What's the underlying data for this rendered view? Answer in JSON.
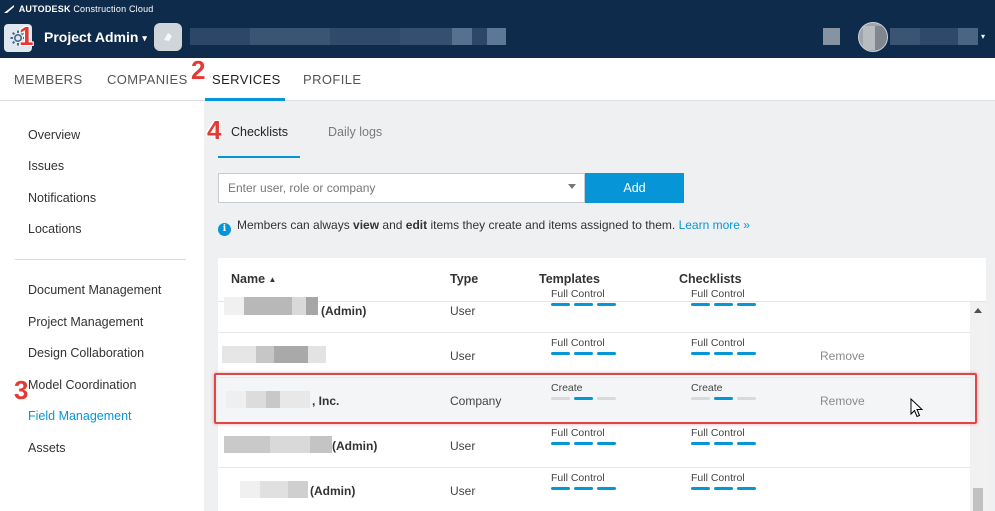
{
  "header": {
    "brand": "AUTODESK",
    "brand_sub": "Construction Cloud",
    "app_title": "Project Admin",
    "app_caret": "▾",
    "avatar_caret": "▾"
  },
  "main_nav": {
    "tabs": [
      {
        "label": "MEMBERS"
      },
      {
        "label": "COMPANIES"
      },
      {
        "label": "SERVICES"
      },
      {
        "label": "PROFILE"
      }
    ],
    "active": "SERVICES"
  },
  "sidebar": {
    "group1": [
      {
        "label": "Overview"
      },
      {
        "label": "Issues"
      },
      {
        "label": "Notifications"
      },
      {
        "label": "Locations"
      }
    ],
    "group2": [
      {
        "label": "Document Management"
      },
      {
        "label": "Project Management"
      },
      {
        "label": "Design Collaboration"
      },
      {
        "label": "Model Coordination"
      },
      {
        "label": "Field Management"
      },
      {
        "label": "Assets"
      }
    ],
    "active": "Field Management"
  },
  "subtabs": [
    {
      "label": "Checklists"
    },
    {
      "label": "Daily logs"
    }
  ],
  "search": {
    "placeholder": "Enter user, role or company"
  },
  "add_button": "Add",
  "info": {
    "pre": "Members can always ",
    "view": "view",
    "mid": " and ",
    "edit": "edit",
    "post": " items they create and items assigned to them.",
    "link": "Learn more »"
  },
  "table": {
    "headers": {
      "name": "Name",
      "name_sort": "▲",
      "type": "Type",
      "templates": "Templates",
      "checklists": "Checklists"
    },
    "rows": [
      {
        "name_suffix": "(Admin)",
        "type": "User",
        "templates": "Full Control",
        "templates_level": 3,
        "checklists": "Full Control",
        "checklists_level": 3,
        "remove": ""
      },
      {
        "name_suffix": "",
        "type": "User",
        "templates": "Full Control",
        "templates_level": 3,
        "checklists": "Full Control",
        "checklists_level": 3,
        "remove": "Remove"
      },
      {
        "name_suffix": ", Inc.",
        "type": "Company",
        "templates": "Create",
        "templates_level": 2,
        "checklists": "Create",
        "checklists_level": 2,
        "remove": "Remove"
      },
      {
        "name_suffix": "(Admin)",
        "type": "User",
        "templates": "Full Control",
        "templates_level": 3,
        "checklists": "Full Control",
        "checklists_level": 3,
        "remove": ""
      },
      {
        "name_suffix": "(Admin)",
        "type": "User",
        "templates": "Full Control",
        "templates_level": 3,
        "checklists": "Full Control",
        "checklists_level": 3,
        "remove": ""
      }
    ]
  },
  "annotations": [
    "1",
    "2",
    "3",
    "4"
  ],
  "colors": {
    "topbar": "#0f2b4c",
    "accent": "#0696d7",
    "highlight": "#e04646",
    "annotation": "#e53935"
  }
}
